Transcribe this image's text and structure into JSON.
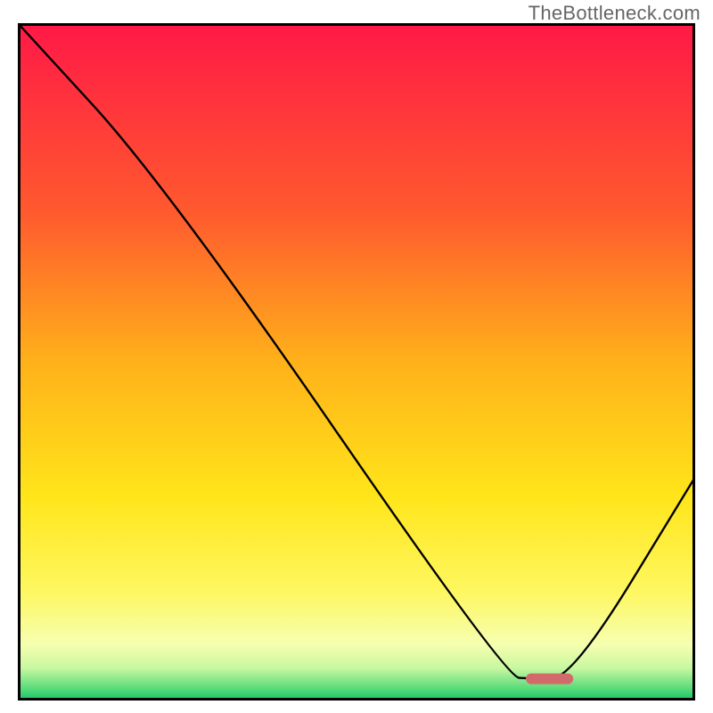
{
  "watermark": "TheBottleneck.com",
  "chart_data": {
    "type": "line",
    "title": "",
    "xlabel": "",
    "ylabel": "",
    "xlim": [
      0,
      100
    ],
    "ylim": [
      0,
      100
    ],
    "grid": false,
    "series": [
      {
        "name": "curve",
        "x": [
          0,
          22,
          72,
          76,
          82,
          100
        ],
        "values": [
          100,
          76,
          3.5,
          3.2,
          3.5,
          33
        ]
      }
    ],
    "marker": {
      "x_start": 75,
      "x_end": 82,
      "y": 3.2,
      "color": "#d36a6a"
    },
    "gradient_stops": [
      {
        "offset": 0,
        "color": "#ff1946"
      },
      {
        "offset": 0.28,
        "color": "#ff5a2e"
      },
      {
        "offset": 0.5,
        "color": "#ffb11a"
      },
      {
        "offset": 0.7,
        "color": "#ffe51a"
      },
      {
        "offset": 0.84,
        "color": "#fef760"
      },
      {
        "offset": 0.92,
        "color": "#f6ffb0"
      },
      {
        "offset": 0.955,
        "color": "#c7f7a0"
      },
      {
        "offset": 0.985,
        "color": "#58db7a"
      },
      {
        "offset": 1.0,
        "color": "#20c76b"
      }
    ],
    "frame_color": "#000000"
  }
}
